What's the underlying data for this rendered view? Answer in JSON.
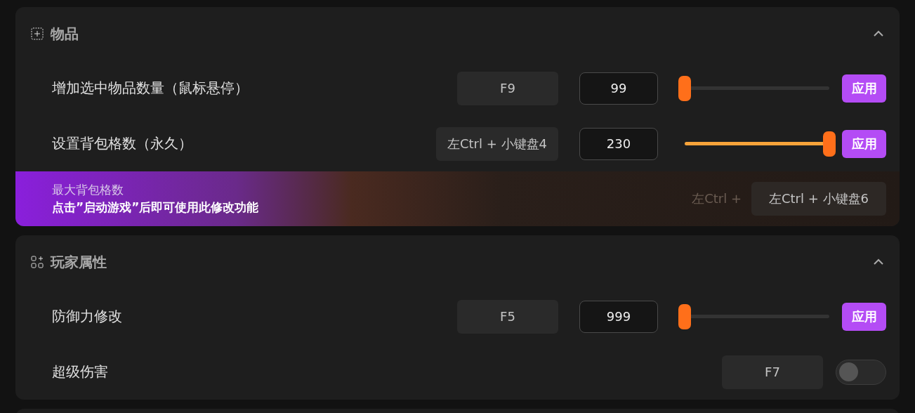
{
  "sections": [
    {
      "title": "物品",
      "expanded": true,
      "rows": [
        {
          "kind": "slider",
          "label": "增加选中物品数量（鼠标悬停）",
          "hotkey": "F9",
          "value": "99",
          "level": 0,
          "button": "应用"
        },
        {
          "kind": "slider",
          "label": "设置背包格数（永久）",
          "hotkey": "左Ctrl + 小键盘4",
          "value": "230",
          "level": 1,
          "button": "应用"
        }
      ],
      "banner": {
        "title": "最大背包格数",
        "message": "点击”启动游戏”后即可使用此修改功能",
        "ghost_hotkey": "左Ctrl +",
        "hotkey": "左Ctrl + 小键盘6"
      }
    },
    {
      "title": "玩家属性",
      "expanded": true,
      "rows": [
        {
          "kind": "slider",
          "label": "防御力修改",
          "hotkey": "F5",
          "value": "999",
          "level": 0,
          "button": "应用"
        },
        {
          "kind": "toggle",
          "label": "超级伤害",
          "hotkey": "F7",
          "on": false
        }
      ]
    }
  ]
}
